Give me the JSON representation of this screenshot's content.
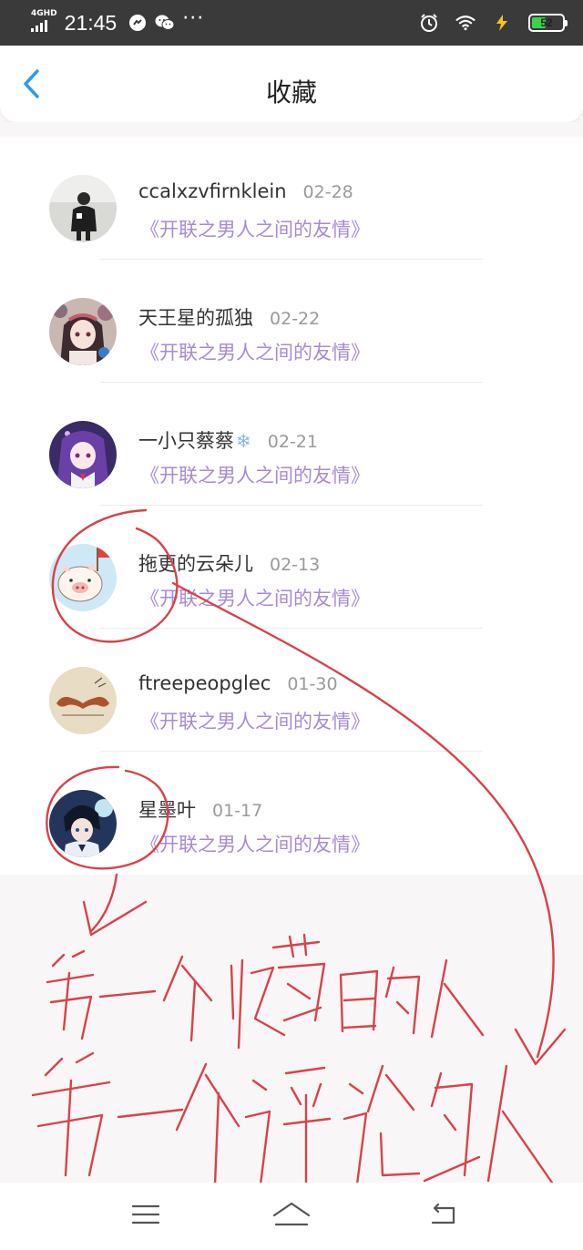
{
  "status_bar": {
    "network": "4GHD",
    "time": "21:45",
    "battery": "52",
    "battery_level": 0.52,
    "icons": [
      "signal-icon",
      "messenger-icon",
      "wechat-icon",
      "more-icon",
      "alarm-icon",
      "wifi-icon",
      "charging-icon",
      "battery-icon"
    ],
    "more": "···"
  },
  "header": {
    "title": "收藏",
    "back_icon": "chevron-left-icon"
  },
  "favorites": [
    {
      "user": "ccalxzvfirnklein",
      "date": "02-28",
      "work": "《开联之男人之间的友情》",
      "emoji": ""
    },
    {
      "user": "天王星的孤独",
      "date": "02-22",
      "work": "《开联之男人之间的友情》",
      "emoji": ""
    },
    {
      "user": "一小只蔡蔡",
      "date": "02-21",
      "work": "《开联之男人之间的友情》",
      "emoji": "❄"
    },
    {
      "user": "拖更的云朵儿",
      "date": "02-13",
      "work": "《开联之男人之间的友情》",
      "emoji": ""
    },
    {
      "user": "ftreepeopglec",
      "date": "01-30",
      "work": "《开联之男人之间的友情》",
      "emoji": ""
    },
    {
      "user": "星墨叶",
      "date": "01-17",
      "work": "《开联之男人之间的友情》",
      "emoji": ""
    }
  ],
  "colors": {
    "status_bar": "#3a3a3a",
    "accent_blue": "#2f9be8",
    "work_title": "#a98bd1",
    "annotation_red": "#d9424a"
  },
  "nav": {
    "icons": [
      "menu-icon",
      "home-icon",
      "back-icon"
    ]
  }
}
